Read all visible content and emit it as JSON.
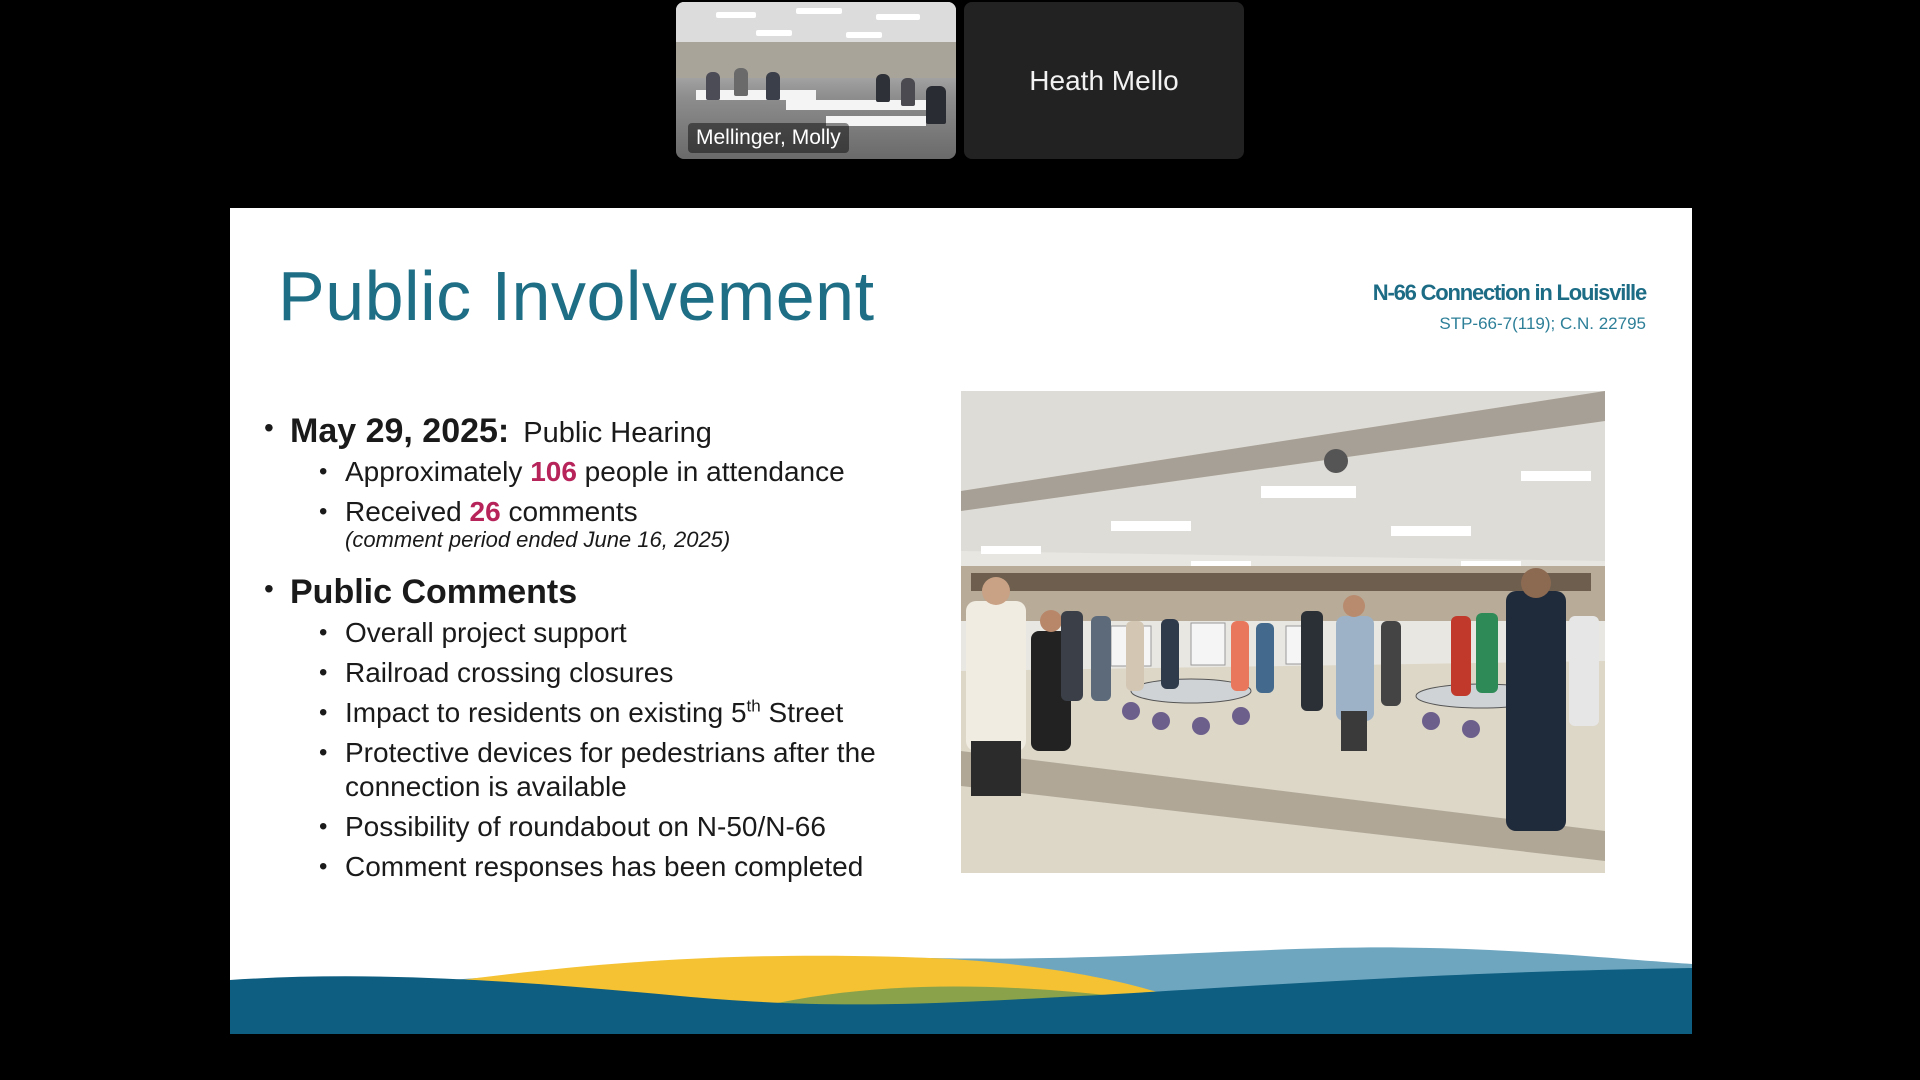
{
  "participants": [
    {
      "name": "Mellinger, Molly",
      "has_video": true
    },
    {
      "name": "Heath Mello",
      "has_video": false
    }
  ],
  "slide": {
    "title": "Public Involvement",
    "project_title": "N-66 Connection in Louisville",
    "project_code": "STP-66-7(119); C.N. 22795",
    "hearing": {
      "date": "May 29, 2025:",
      "label": "Public Hearing",
      "attendance": {
        "pre": "Approximately ",
        "value": "106",
        "post": " people in attendance"
      },
      "comments": {
        "pre": "Received ",
        "value": "26",
        "post": " comments"
      },
      "note": "(comment period ended June 16, 2025)"
    },
    "public_comments": {
      "heading": "Public Comments",
      "items": [
        "Overall project support",
        "Railroad crossing closures",
        {
          "pre": "Impact to residents on existing 5",
          "sup": "th",
          "post": " Street"
        },
        "Protective devices for pedestrians after the connection is available",
        "Possibility of roundabout on N-50/N-66",
        "Comment responses has been completed"
      ]
    },
    "colors": {
      "title": "#1e6e86",
      "highlight": "#b7245a",
      "wave_teal": "#0d5e80",
      "wave_yellow": "#f4c233",
      "wave_green": "#8aa24a",
      "wave_light_blue": "#6ea6c0"
    }
  }
}
